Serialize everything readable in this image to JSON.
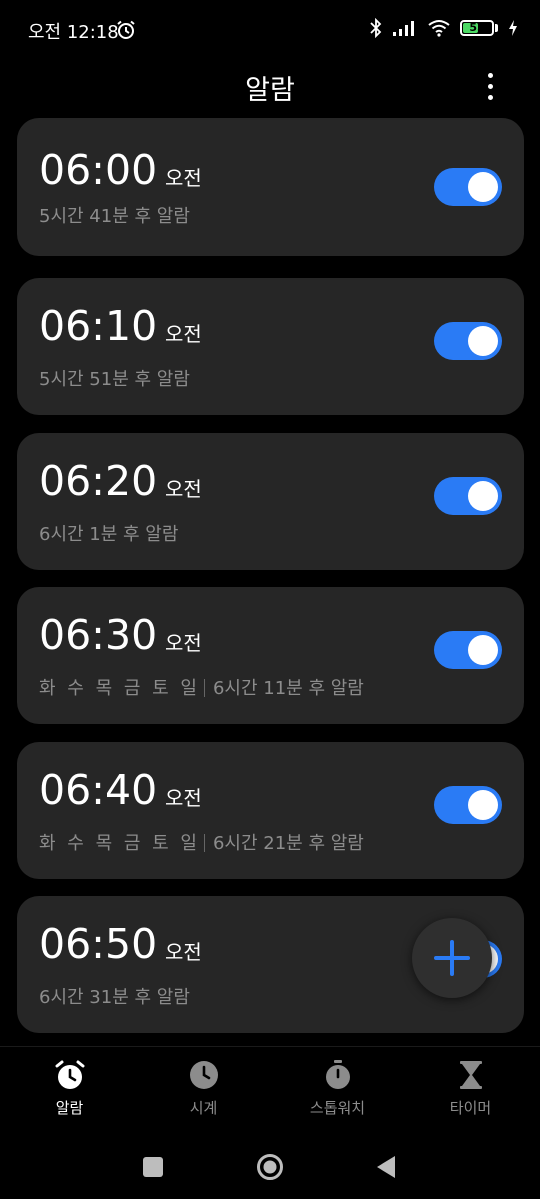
{
  "status_bar": {
    "time": "오전 12:18",
    "battery_level": "55",
    "battery_percent": 55
  },
  "header": {
    "title": "알람"
  },
  "alarms": [
    {
      "time": "06:00",
      "ampm": "오전",
      "days": "",
      "remaining": "5시간 41분 후 알람",
      "enabled": true
    },
    {
      "time": "06:10",
      "ampm": "오전",
      "days": "",
      "remaining": "5시간 51분 후 알람",
      "enabled": true
    },
    {
      "time": "06:20",
      "ampm": "오전",
      "days": "",
      "remaining": "6시간 1분 후 알람",
      "enabled": true
    },
    {
      "time": "06:30",
      "ampm": "오전",
      "days": "화 수 목 금 토 일",
      "remaining": "6시간 11분 후 알람",
      "enabled": true
    },
    {
      "time": "06:40",
      "ampm": "오전",
      "days": "화 수 목 금 토 일",
      "remaining": "6시간 21분 후 알람",
      "enabled": true
    },
    {
      "time": "06:50",
      "ampm": "오전",
      "days": "",
      "remaining": "6시간 31분 후 알람",
      "enabled": true
    }
  ],
  "bottom_nav": {
    "items": [
      {
        "label": "알람",
        "icon": "alarm-clock-icon",
        "active": true
      },
      {
        "label": "시계",
        "icon": "clock-icon",
        "active": false
      },
      {
        "label": "스톱워치",
        "icon": "stopwatch-icon",
        "active": false
      },
      {
        "label": "타이머",
        "icon": "hourglass-icon",
        "active": false
      }
    ]
  },
  "colors": {
    "accent": "#2a7bf5",
    "card": "#262626",
    "background": "#000000",
    "secondary_text": "#8c8c8c"
  }
}
